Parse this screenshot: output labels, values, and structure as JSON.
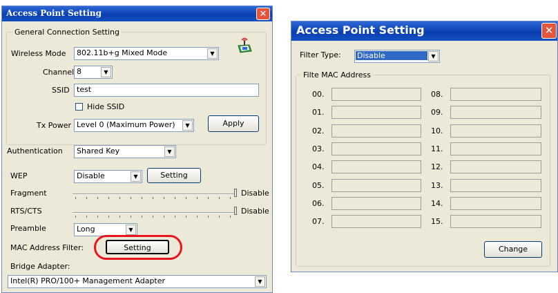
{
  "left_dialog": {
    "title": "Access Point Setting",
    "close_glyph": "✕",
    "general_group_title": "General Connection Setting",
    "wireless_mode_label": "Wireless Mode",
    "wireless_mode_value": "802.11b+g Mixed Mode",
    "channel_label": "Channel",
    "channel_value": "8",
    "ssid_label": "SSID",
    "ssid_value": "test",
    "hide_ssid_label": "Hide SSID",
    "tx_power_label": "Tx Power",
    "tx_power_value": "Level 0 (Maximum Power)",
    "apply_label": "Apply",
    "authentication_label": "Authentication",
    "authentication_value": "Shared Key",
    "wep_label": "WEP",
    "wep_value": "Disable",
    "wep_setting_label": "Setting",
    "fragment_label": "Fragment",
    "fragment_value": "Disable",
    "rts_label": "RTS/CTS",
    "rts_value": "Disable",
    "preamble_label": "Preamble",
    "preamble_value": "Long",
    "mac_filter_label": "MAC Address Filter:",
    "mac_filter_button": "Setting",
    "bridge_label": "Bridge Adapter:",
    "bridge_value": "Intel(R) PRO/100+ Management Adapter",
    "highlight_color": "#e8141c",
    "icon": "wireless-network-icon"
  },
  "right_dialog": {
    "title": "Access Point Setting",
    "close_glyph": "✕",
    "filter_type_label": "Filter Type:",
    "filter_type_value": "Disable",
    "group_title": "Filte MAC Address",
    "slots_left": [
      "00.",
      "01.",
      "02.",
      "03.",
      "04.",
      "05.",
      "06.",
      "07."
    ],
    "slots_right": [
      "08.",
      "09.",
      "10.",
      "11.",
      "12.",
      "13.",
      "14.",
      "15."
    ],
    "change_label": "Change"
  }
}
